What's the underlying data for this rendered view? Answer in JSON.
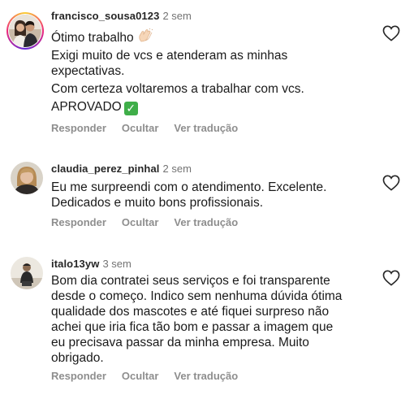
{
  "comments": [
    {
      "username": "francisco_sousa0123",
      "time": "2 sem",
      "lines": [
        "Ótimo trabalho",
        "Exigi muito de vcs e atenderam as minhas expectativas.",
        "Com certeza voltaremos a trabalhar com vcs.",
        "APROVADO"
      ],
      "emoji_after_line_0": "clapping-hands-icon",
      "emoji_after_line_3": "check-mark-button-icon",
      "reply": "Responder",
      "hide": "Ocultar",
      "translate": "Ver tradução",
      "has_story_ring": true
    },
    {
      "username": "claudia_perez_pinhal",
      "time": "2 sem",
      "lines": [
        "Eu me surpreendi com o atendimento. Excelente. Dedicados e muito bons profissionais."
      ],
      "reply": "Responder",
      "hide": "Ocultar",
      "translate": "Ver tradução",
      "has_story_ring": false
    },
    {
      "username": "italo13yw",
      "time": "3 sem",
      "lines": [
        "Bom dia contratei seus serviços e foi transparente desde o começo. Indico sem nenhuma dúvida ótima qualidade dos mascotes e até fiquei surpreso não achei que iria fica tão bom e passar a imagem que eu precisava passar da minha empresa. Muito obrigado."
      ],
      "reply": "Responder",
      "hide": "Ocultar",
      "translate": "Ver tradução",
      "has_story_ring": false
    }
  ],
  "colors": {
    "username": "#262626",
    "meta": "#737373",
    "action": "#8e8e8e",
    "text": "#1a1a1a",
    "check_green": "#3fae49"
  }
}
